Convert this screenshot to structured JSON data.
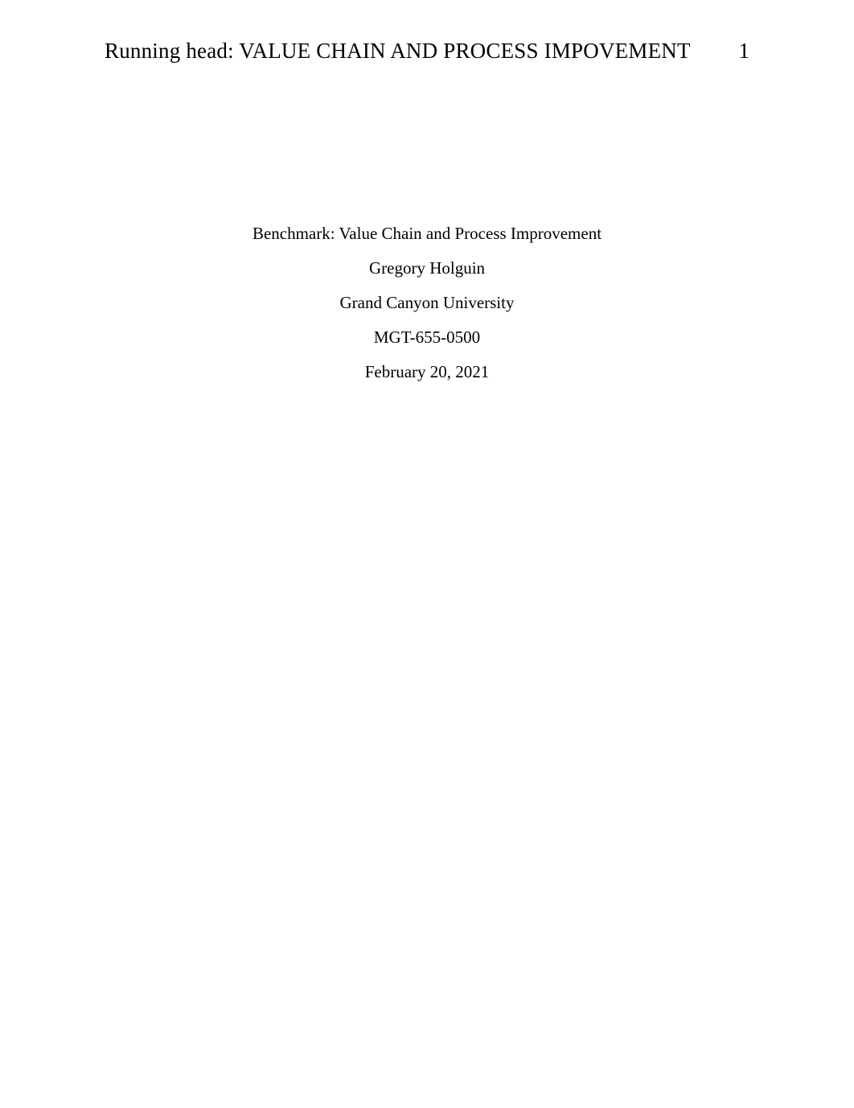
{
  "header": {
    "running_head_prefix": "Running head: ",
    "running_head_text": "VALUE CHAIN AND PROCESS IMPOVEMENT",
    "page_number": "1"
  },
  "title_block": {
    "title": "Benchmark: Value Chain and Process Improvement",
    "author": "Gregory Holguin",
    "institution": "Grand Canyon University",
    "course": "MGT-655-0500",
    "date": "February 20, 2021"
  }
}
